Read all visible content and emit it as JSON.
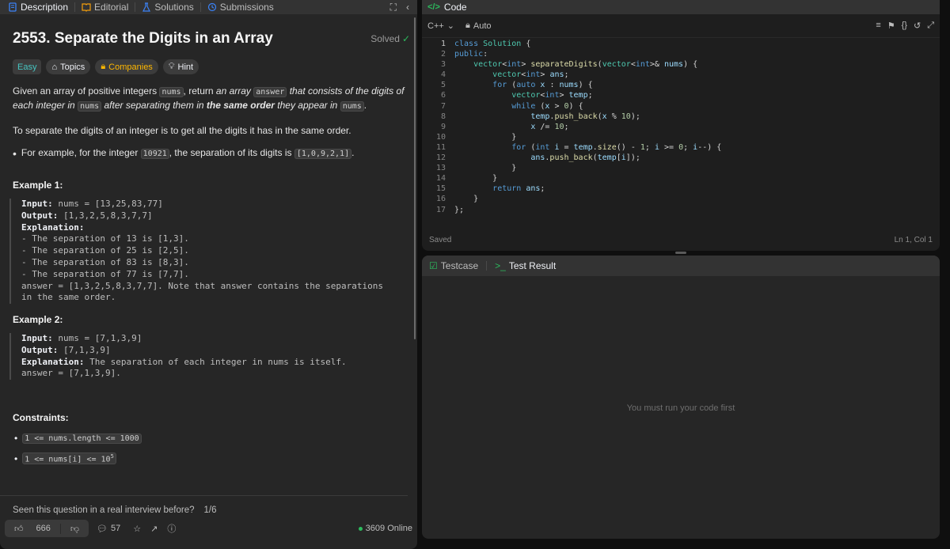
{
  "left_tabs": [
    {
      "label": "Description",
      "icon": "description-icon",
      "color": "#3b82f6"
    },
    {
      "label": "Editorial",
      "icon": "book-icon",
      "color": "#f59e0b"
    },
    {
      "label": "Solutions",
      "icon": "flask-icon",
      "color": "#3b82f6"
    },
    {
      "label": "Submissions",
      "icon": "history-icon",
      "color": "#3b82f6"
    }
  ],
  "problem": {
    "title": "2553. Separate the Digits in an Array",
    "status": "Solved",
    "difficulty": "Easy",
    "tags": [
      "Topics",
      "Companies",
      "Hint"
    ],
    "p1": {
      "a": "Given an array of positive integers ",
      "c1": "nums",
      "b": ", return ",
      "i1": "an array ",
      "c2": "answer",
      "i2": " that consists of the digits of each integer in ",
      "c3": "nums",
      "i3": " after separating them in ",
      "bold": "the same order",
      "i4": " they appear in ",
      "c4": "nums",
      "end": "."
    },
    "p2": "To separate the digits of an integer is to get all the digits it has in the same order.",
    "p3": {
      "a": "For example, for the integer ",
      "c1": "10921",
      "b": ", the separation of its digits is ",
      "c2": "[1,0,9,2,1]",
      "end": "."
    }
  },
  "example1": {
    "heading": "Example 1:",
    "input_label": "Input:",
    "input": " nums = [13,25,83,77]",
    "output_label": "Output:",
    "output": " [1,3,2,5,8,3,7,7]",
    "explanation_label": "Explanation:",
    "explanation": "\n- The separation of 13 is [1,3].\n- The separation of 25 is [2,5].\n- The separation of 83 is [8,3].\n- The separation of 77 is [7,7].\nanswer = [1,3,2,5,8,3,7,7]. Note that answer contains the separations in the same order."
  },
  "example2": {
    "heading": "Example 2:",
    "input_label": "Input:",
    "input": " nums = [7,1,3,9]",
    "output_label": "Output:",
    "output": " [7,1,3,9]",
    "explanation_label": "Explanation:",
    "explanation": " The separation of each integer in nums is itself.\nanswer = [7,1,3,9]."
  },
  "constraints": {
    "heading": "Constraints:",
    "c1": "1 <= nums.length <= 1000",
    "c2_base": "1 <= nums[i] <= 10",
    "c2_sup": "5"
  },
  "seen": {
    "question": "Seen this question in a real interview before?",
    "page": "1/6"
  },
  "footer": {
    "likes": "666",
    "comments": "57",
    "online": "3609 Online"
  },
  "code": {
    "tab_label": "Code",
    "language": "C++",
    "mode": "Auto",
    "status_left": "Saved",
    "status_right": "Ln 1, Col 1",
    "lines": [
      "1",
      "2",
      "3",
      "4",
      "5",
      "6",
      "7",
      "8",
      "9",
      "10",
      "11",
      "12",
      "13",
      "14",
      "15",
      "16",
      "17"
    ]
  },
  "test": {
    "tab1": "Testcase",
    "tab2": "Test Result",
    "message": "You must run your code first"
  }
}
